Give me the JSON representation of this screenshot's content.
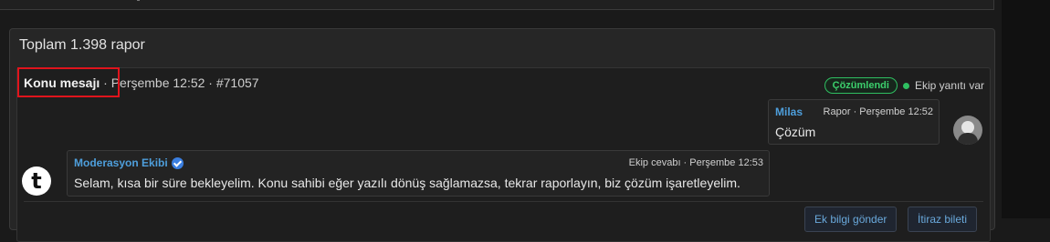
{
  "panel": {
    "title": "Toplam 1.398 rapor"
  },
  "report": {
    "title": "Konu mesajı",
    "meta": " · Perşembe 12:52 · #71057",
    "status_badge": "Çözümlendi",
    "team_status": "Ekip yanıtı var"
  },
  "messages": [
    {
      "author": "Milas",
      "meta": "Rapor · Perşembe 12:52",
      "text": "Çözüm"
    },
    {
      "author": "Moderasyon Ekibi",
      "meta": "Ekip cevabı · Perşembe 12:53",
      "text": "Selam, kısa bir süre bekleyelim. Konu sahibi eğer yazılı dönüş sağlamazsa, tekrar raporlayın, biz çözüm işaretleyelim.",
      "avatar_letter": "t"
    }
  ],
  "actions": {
    "more_info": "Ek bilgi gönder",
    "appeal": "İtiraz bileti"
  },
  "colors": {
    "accent_blue": "#4e9fdc",
    "success_green": "#2fbf61",
    "highlight_red": "#e0141c"
  }
}
